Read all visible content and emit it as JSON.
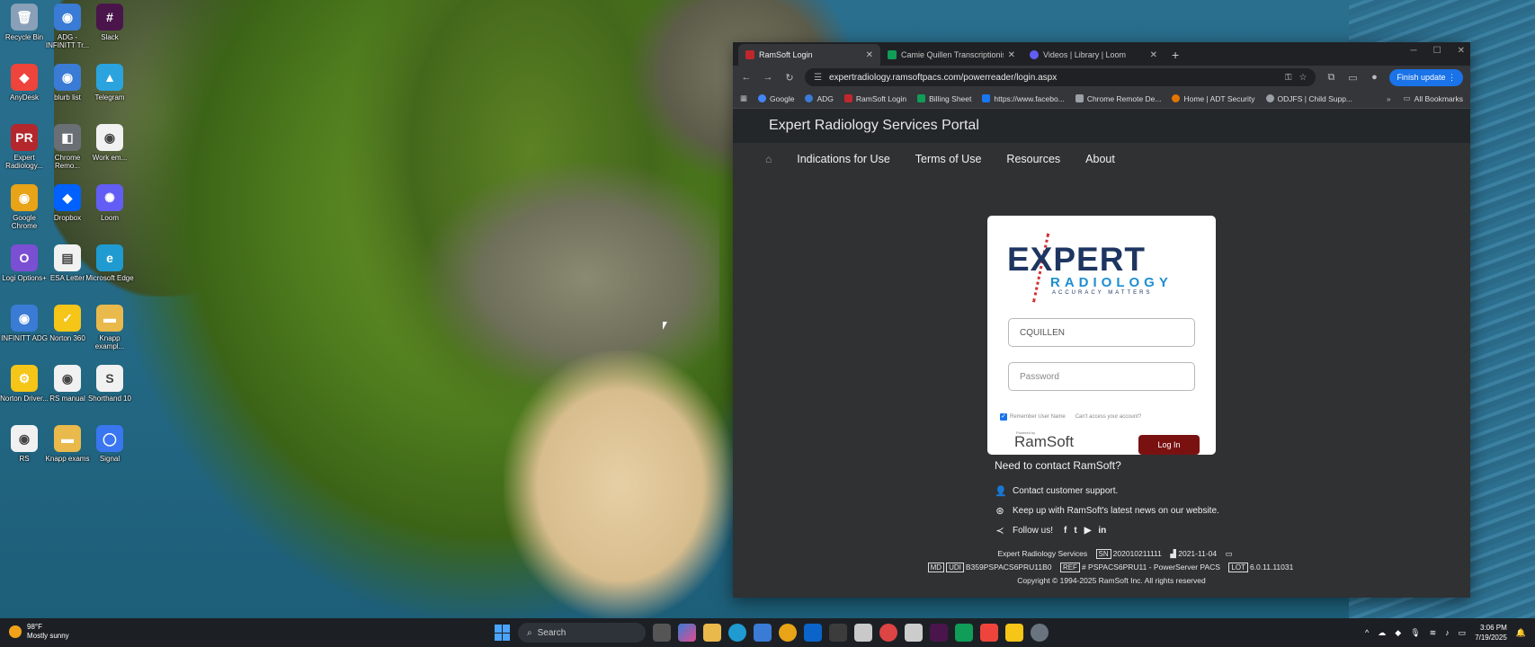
{
  "desktop": {
    "icons": [
      {
        "label": "Recycle Bin",
        "color": "#8aa0b8",
        "glyph": "🗑"
      },
      {
        "label": "ADG - INFINITT Tr...",
        "color": "#3a7bd5",
        "glyph": "◉"
      },
      {
        "label": "Slack",
        "color": "#4a154b",
        "glyph": "#"
      },
      {
        "label": "AnyDesk",
        "color": "#ef443b",
        "glyph": "◆"
      },
      {
        "label": "blurb list",
        "color": "#3a7bd5",
        "glyph": "◉"
      },
      {
        "label": "Telegram",
        "color": "#2aa3df",
        "glyph": "▲"
      },
      {
        "label": "Expert Radiology...",
        "color": "#b3272d",
        "glyph": "PR"
      },
      {
        "label": "Chrome Remo...",
        "color": "#6a6f75",
        "glyph": "◧"
      },
      {
        "label": "Work em...",
        "color": "#f1f1f1",
        "glyph": "◉"
      },
      {
        "label": "Google Chrome",
        "color": "#e8a317",
        "glyph": "◉"
      },
      {
        "label": "Dropbox",
        "color": "#0061fe",
        "glyph": "◆"
      },
      {
        "label": "Loom",
        "color": "#625df5",
        "glyph": "✺"
      },
      {
        "label": "Logi Options+",
        "color": "#7b4fd3",
        "glyph": "O"
      },
      {
        "label": "ESA Letter",
        "color": "#f1f1f1",
        "glyph": "▤"
      },
      {
        "label": "Microsoft Edge",
        "color": "#1f9bd1",
        "glyph": "e"
      },
      {
        "label": "INFINITT ADG",
        "color": "#3a7bd5",
        "glyph": "◉"
      },
      {
        "label": "Norton 360",
        "color": "#f5c518",
        "glyph": "✓"
      },
      {
        "label": "Knapp exampl...",
        "color": "#e9b94b",
        "glyph": "▬"
      },
      {
        "label": "Norton Driver...",
        "color": "#f5c518",
        "glyph": "⚙"
      },
      {
        "label": "RS manual",
        "color": "#f1f1f1",
        "glyph": "◉"
      },
      {
        "label": "Shorthand 10",
        "color": "#f1f1f1",
        "glyph": "S"
      },
      {
        "label": "RS",
        "color": "#f1f1f1",
        "glyph": "◉"
      },
      {
        "label": "Knapp exams",
        "color": "#e9b94b",
        "glyph": "▬"
      },
      {
        "label": "Signal",
        "color": "#3a76f0",
        "glyph": "◯"
      }
    ]
  },
  "browser": {
    "tabs": [
      {
        "title": "RamSoft Login",
        "active": true,
        "fav_color": "#c0272d"
      },
      {
        "title": "Camie Quillen Transcriptionist",
        "active": false,
        "fav_color": "#0f9d58"
      },
      {
        "title": "Videos | Library | Loom",
        "active": false,
        "fav_color": "#625df5"
      }
    ],
    "new_tab": "+",
    "url": "expertradiology.ramsoftpacs.com/powerreader/login.aspx",
    "finish_update": "Finish update",
    "bookmarks": [
      {
        "label": "Google",
        "color": "#4285f4"
      },
      {
        "label": "ADG",
        "color": "#3a7bd5"
      },
      {
        "label": "RamSoft Login",
        "color": "#c0272d"
      },
      {
        "label": "Billing Sheet",
        "color": "#0f9d58"
      },
      {
        "label": "https://www.facebo...",
        "color": "#1877f2"
      },
      {
        "label": "Chrome Remote De...",
        "color": "#9aa0a6"
      },
      {
        "label": "Home | ADT Security",
        "color": "#e37400"
      },
      {
        "label": "ODJFS | Child Supp...",
        "color": "#9aa0a6"
      }
    ],
    "all_bookmarks": "All Bookmarks"
  },
  "portal": {
    "title": "Expert Radiology Services Portal",
    "nav": [
      "Indications for Use",
      "Terms of Use",
      "Resources",
      "About"
    ],
    "logo": {
      "expert": "EXPERT",
      "radiology": "RADIOLOGY",
      "tagline": "ACCURACY MATTERS"
    },
    "login": {
      "username_value": "CQUILLEN",
      "password_placeholder": "Password",
      "remember_label": "Remember User Name",
      "cant_access": "Can't access your account?",
      "powered_by": "Powered by",
      "ramsoft": "RamSoft",
      "login_button": "Log In"
    },
    "contact": {
      "heading": "Need to contact RamSoft?",
      "support": "Contact customer support.",
      "news": "Keep up with RamSoft's latest news on our website.",
      "follow": "Follow us!",
      "social": [
        "f",
        "t",
        "▶",
        "in"
      ]
    },
    "footer": {
      "company": "Expert Radiology Services",
      "sn_label": "SN",
      "sn": "202010211111",
      "date": "2021-11-04",
      "md": "MD",
      "udi": "UDI",
      "udi_value": "B359PSPACS6PRU11B0",
      "ref": "REF",
      "ref_value": "# PSPACS6PRU11 - PowerServer PACS",
      "lot": "LOT",
      "lot_value": "6.0.11.11031",
      "copyright": "Copyright © 1994-2025 RamSoft Inc. All rights reserved"
    }
  },
  "taskbar": {
    "weather_temp": "98°F",
    "weather_desc": "Mostly sunny",
    "search": "Search",
    "time": "3:06 PM",
    "date": "7/19/2025"
  }
}
